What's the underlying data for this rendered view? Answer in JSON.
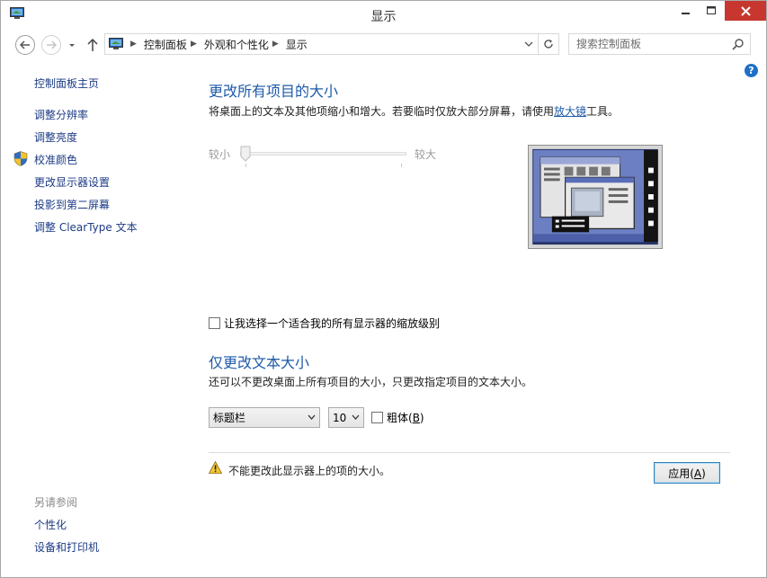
{
  "window": {
    "title": "显示"
  },
  "address": {
    "crumbs": [
      "控制面板",
      "外观和个性化",
      "显示"
    ]
  },
  "search": {
    "placeholder": "搜索控制面板"
  },
  "help": {
    "label": "?"
  },
  "sidebar": {
    "home": "控制面板主页",
    "items": [
      {
        "label": "调整分辨率"
      },
      {
        "label": "调整亮度"
      },
      {
        "label": "校准颜色"
      },
      {
        "label": "更改显示器设置"
      },
      {
        "label": "投影到第二屏幕"
      },
      {
        "label": "调整 ClearType 文本"
      }
    ],
    "see_also_heading": "另请参阅",
    "see_also": [
      {
        "label": "个性化"
      },
      {
        "label": "设备和打印机"
      }
    ]
  },
  "main": {
    "section1_title": "更改所有项目的大小",
    "section1_desc_before": "将桌面上的文本及其他项缩小和增大。若要临时仅放大部分屏幕，请使用",
    "section1_desc_link": "放大镜",
    "section1_desc_after": "工具。",
    "slider_small": "较小",
    "slider_large": "较大",
    "slider_level": 0,
    "checkbox_label": "让我选择一个适合我的所有显示器的缩放级别",
    "checkbox_checked": false,
    "section2_title": "仅更改文本大小",
    "section2_desc": "还可以不更改桌面上所有项目的大小，只更改指定项目的文本大小。",
    "item_select_value": "标题栏",
    "size_select_value": "10",
    "bold_label_prefix": "粗体(",
    "bold_accesskey": "B",
    "bold_label_suffix": ")",
    "bold_checked": false,
    "warning_text": "不能更改此显示器上的项的大小。",
    "apply_prefix": "应用(",
    "apply_accesskey": "A",
    "apply_suffix": ")"
  },
  "colors": {
    "link": "#1c3b85",
    "heading": "#1e5aa8",
    "close_button": "#c7372f",
    "help": "#1f6fc6"
  },
  "icons": [
    "display-icon",
    "minimize-icon",
    "maximize-icon",
    "close-icon",
    "back-arrow-icon",
    "forward-arrow-icon",
    "chevron-down-icon",
    "up-arrow-icon",
    "control-panel-icon",
    "chevron-right-icon",
    "refresh-icon",
    "search-icon",
    "help-icon",
    "shield-icon",
    "warning-icon"
  ]
}
